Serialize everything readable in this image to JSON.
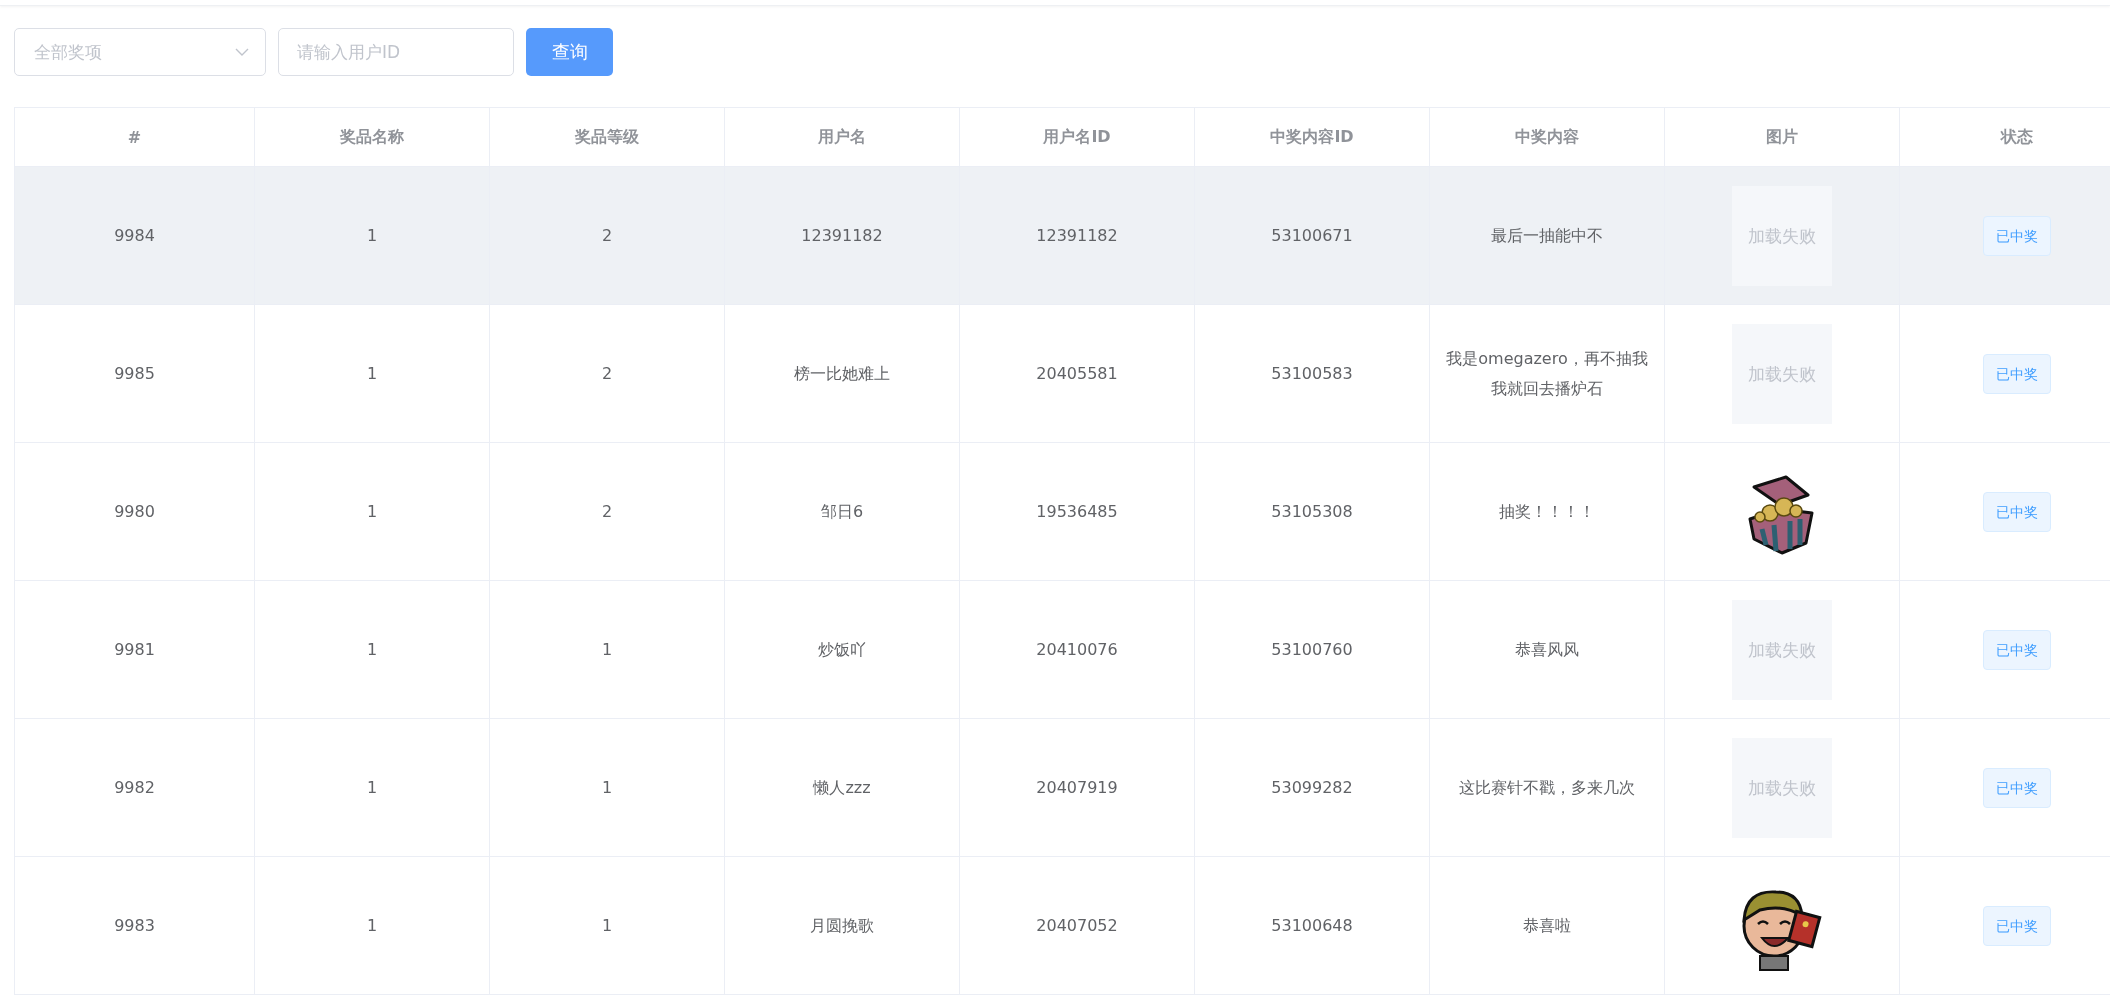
{
  "filters": {
    "prize_select": {
      "placeholder": "全部奖项"
    },
    "user_id_field": {
      "placeholder": "请输入用户ID"
    },
    "query_button": "查询"
  },
  "table": {
    "columns": [
      "#",
      "奖品名称",
      "奖品等级",
      "用户名",
      "用户名ID",
      "中奖内容ID",
      "中奖内容",
      "图片",
      "状态"
    ],
    "rows": [
      {
        "highlighted": true,
        "cells": [
          "9984",
          "1",
          "2",
          "12391182",
          "12391182",
          "53100671",
          "最后一抽能中不"
        ],
        "image": {
          "kind": "failed",
          "text": "加载失败"
        },
        "status": "已中奖"
      },
      {
        "highlighted": false,
        "cells": [
          "9985",
          "1",
          "2",
          "榜一比她难上",
          "20405581",
          "53100583",
          "我是omegazero，再不抽我我就回去播炉石"
        ],
        "image": {
          "kind": "failed",
          "text": "加载失败"
        },
        "status": "已中奖"
      },
      {
        "highlighted": false,
        "cells": [
          "9980",
          "1",
          "2",
          "邹日6",
          "19536485",
          "53105308",
          "抽奖！！！！"
        ],
        "image": {
          "kind": "chest"
        },
        "status": "已中奖"
      },
      {
        "highlighted": false,
        "cells": [
          "9981",
          "1",
          "1",
          "炒饭吖",
          "20410076",
          "53100760",
          "恭喜风风"
        ],
        "image": {
          "kind": "failed",
          "text": "加载失败"
        },
        "status": "已中奖"
      },
      {
        "highlighted": false,
        "cells": [
          "9982",
          "1",
          "1",
          "懒人zzz",
          "20407919",
          "53099282",
          "这比赛针不戳，多来几次"
        ],
        "image": {
          "kind": "failed",
          "text": "加载失败"
        },
        "status": "已中奖"
      },
      {
        "highlighted": false,
        "cells": [
          "9983",
          "1",
          "1",
          "月圆挽歌",
          "20407052",
          "53100648",
          "恭喜啦"
        ],
        "image": {
          "kind": "avatar"
        },
        "status": "已中奖"
      }
    ]
  }
}
